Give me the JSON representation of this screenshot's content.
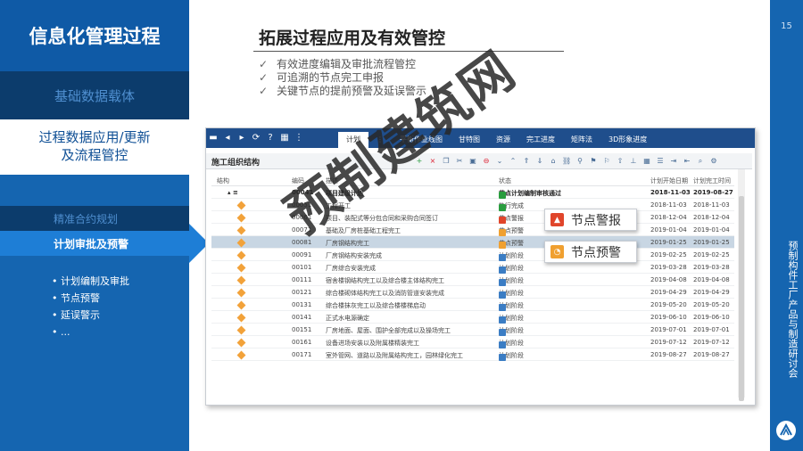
{
  "sidebar": {
    "title": "信息化管理过程",
    "section1": "基础数据载体",
    "section2_line1": "过程数据应用/更新",
    "section2_line2": "及流程管控",
    "sub1": "精准合约规划",
    "sub2": "计划审批及预警",
    "bullets": [
      "计划编制及审批",
      "节点预警",
      "延误警示",
      "..."
    ]
  },
  "page_number": "15",
  "side_caption": "预制构件工厂产品与制造研讨会",
  "heading": {
    "title": "拓展过程应用及有效管控",
    "checks": [
      "有效进度编辑及审批流程管控",
      "可追溯的节点完工申报",
      "关键节点的提前预警及延误警示"
    ]
  },
  "app": {
    "toolbar_icons": [
      "save-icon",
      "prev-icon",
      "next-icon",
      "refresh-icon",
      "help-icon",
      "table-icon",
      "menu-icon"
    ],
    "toolbar_glyphs": [
      "▬",
      "◂",
      "▸",
      "⟳",
      "?",
      "▦",
      "⋮"
    ],
    "tabs": [
      "计划",
      "⋮",
      "平衡作业线图",
      "甘特图",
      "资源",
      "完工进度",
      "矩阵法",
      "3D形象进度"
    ],
    "panel_title": "施工组织结构",
    "columns": [
      "结构",
      "编码",
      "描述",
      "状态",
      "计划开始日期",
      "计划完工时间"
    ],
    "rows": [
      {
        "code": "00041",
        "desc": "项目建设计划",
        "status": "节点计划编制审核通过",
        "start": "2018-11-03",
        "end": "2019-08-27",
        "status_color": "#2a9d3f"
      },
      {
        "code": "00051",
        "desc": "工程开工",
        "status": "执行完成",
        "start": "2018-11-03",
        "end": "2018-11-03",
        "status_color": "#2a9d3f"
      },
      {
        "code": "00061",
        "desc": "项目、装配式等分包合同和采购合同签订",
        "status": "节点警报",
        "start": "2018-12-04",
        "end": "2018-12-04",
        "status_color": "#e0452b"
      },
      {
        "code": "00071",
        "desc": "基础及厂房桩基础工程完工",
        "status": "节点预警",
        "start": "2019-01-04",
        "end": "2019-01-04",
        "status_color": "#f0a030"
      },
      {
        "code": "00081",
        "desc": "厂房钢结构完工",
        "status": "节点预警",
        "start": "2019-01-25",
        "end": "2019-01-25",
        "status_color": "#f0a030"
      },
      {
        "code": "00091",
        "desc": "厂房钢结构安装完成",
        "status": "计划阶段",
        "start": "2019-02-25",
        "end": "2019-02-25",
        "status_color": "#3b7dc4"
      },
      {
        "code": "00101",
        "desc": "厂房综合安装完成",
        "status": "计划阶段",
        "start": "2019-03-28",
        "end": "2019-03-28",
        "status_color": "#3b7dc4"
      },
      {
        "code": "00111",
        "desc": "宿舍楼钢结构完工以及综合楼主体结构完工",
        "status": "计划阶段",
        "start": "2019-04-08",
        "end": "2019-04-08",
        "status_color": "#3b7dc4"
      },
      {
        "code": "00121",
        "desc": "综合楼砌体结构完工以及消防管道安装完成",
        "status": "计划阶段",
        "start": "2019-04-29",
        "end": "2019-04-29",
        "status_color": "#3b7dc4"
      },
      {
        "code": "00131",
        "desc": "综合楼抹灰完工以及综合楼楼梯启动",
        "status": "计划阶段",
        "start": "2019-05-20",
        "end": "2019-05-20",
        "status_color": "#3b7dc4"
      },
      {
        "code": "00141",
        "desc": "正式水电源确定",
        "status": "计划阶段",
        "start": "2019-06-10",
        "end": "2019-06-10",
        "status_color": "#3b7dc4"
      },
      {
        "code": "00151",
        "desc": "厂房地面、屋面、围护全部完成以及操场完工",
        "status": "计划阶段",
        "start": "2019-07-01",
        "end": "2019-07-01",
        "status_color": "#3b7dc4"
      },
      {
        "code": "00161",
        "desc": "设备进场安装以及附属楼精装完工",
        "status": "计划阶段",
        "start": "2019-07-12",
        "end": "2019-07-12",
        "status_color": "#3b7dc4"
      },
      {
        "code": "00171",
        "desc": "室外管网、道路以及附属结构完工，园林绿化完工",
        "status": "计划阶段",
        "start": "2019-08-27",
        "end": "2019-08-27",
        "status_color": "#3b7dc4"
      }
    ],
    "callout_alarm": "节点警报",
    "callout_warning": "节点预警"
  },
  "watermark": "预制建筑网",
  "colors": {
    "primary_blue": "#1565b0",
    "dark_navy": "#0c3c6c",
    "highlight_blue": "#1e7ed6",
    "alarm_red": "#e0452b",
    "warning_orange": "#f0a030"
  }
}
